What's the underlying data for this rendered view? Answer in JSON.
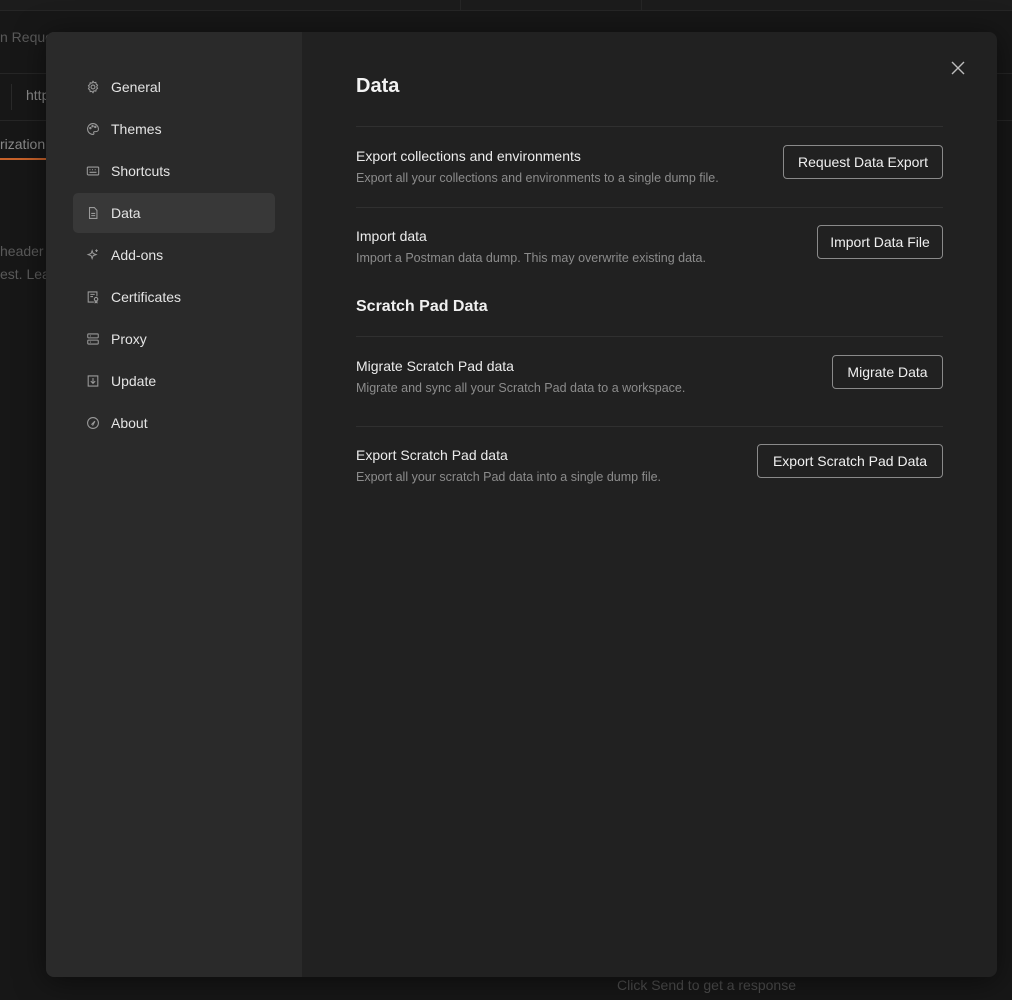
{
  "background": {
    "tab_text": "n Reque",
    "url_text": "http",
    "tab_partial": "rization",
    "line1": "header",
    "line2": "est. Lea",
    "footer": "Click Send to get a response"
  },
  "sidebar": {
    "items": [
      {
        "label": "General",
        "icon": "gear-icon",
        "active": false
      },
      {
        "label": "Themes",
        "icon": "palette-icon",
        "active": false
      },
      {
        "label": "Shortcuts",
        "icon": "keyboard-icon",
        "active": false
      },
      {
        "label": "Data",
        "icon": "file-icon",
        "active": true
      },
      {
        "label": "Add-ons",
        "icon": "sparkle-icon",
        "active": false
      },
      {
        "label": "Certificates",
        "icon": "certificate-icon",
        "active": false
      },
      {
        "label": "Proxy",
        "icon": "server-icon",
        "active": false
      },
      {
        "label": "Update",
        "icon": "download-icon",
        "active": false
      },
      {
        "label": "About",
        "icon": "info-icon",
        "active": false
      }
    ]
  },
  "main": {
    "title": "Data",
    "rows": [
      {
        "title": "Export collections and environments",
        "description": "Export all your collections and environments to a single dump file.",
        "button": "Request Data Export"
      },
      {
        "title": "Import data",
        "description": "Import a Postman data dump. This may overwrite existing data.",
        "button": "Import Data File"
      }
    ],
    "scratch_section_title": "Scratch Pad Data",
    "scratch_rows": [
      {
        "title": "Migrate Scratch Pad data",
        "description": "Migrate and sync all your Scratch Pad data to a workspace.",
        "button": "Migrate Data"
      },
      {
        "title": "Export Scratch Pad data",
        "description": "Export all your scratch Pad data into a single dump file.",
        "button": "Export Scratch Pad Data"
      }
    ]
  },
  "colors": {
    "modal_bg": "#212121",
    "sidebar_bg": "#2a2a2a",
    "active_item_bg": "#383838",
    "accent": "#c8622a"
  }
}
